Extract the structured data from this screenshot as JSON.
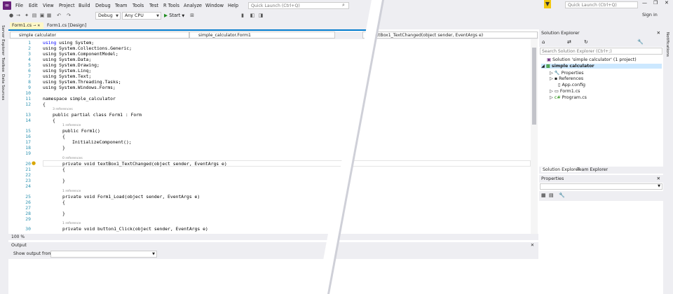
{
  "menu": {
    "file": "File",
    "edit": "Edit",
    "view": "View",
    "project": "Project",
    "build": "Build",
    "debug": "Debug",
    "team": "Team",
    "tools": "Tools",
    "test": "Test",
    "rtools": "R Tools",
    "analyze": "Analyze",
    "window": "Window",
    "help": "Help"
  },
  "toolbar": {
    "config": "Debug",
    "platform": "Any CPU",
    "start": "Start",
    "quick_launch": "Quick Launch (Ctrl+Q)",
    "sign_in": "Sign in"
  },
  "leftdock": {
    "server_explorer": "Server Explorer",
    "toolbox": "Toolbox",
    "data_sources": "Data Sources"
  },
  "rightdock": {
    "notifications": "Notifications"
  },
  "tabs": {
    "form1_cs": "Form1.cs",
    "form1_design": "Form1.cs [Design]"
  },
  "navbar": {
    "project": "simple calculator",
    "class": "simple_calculator.Form1",
    "member": "textBox1_TextChanged(object sender, EventArgs e)"
  },
  "code": {
    "l1": "using System;",
    "l2": "using System.Collections.Generic;",
    "l3": "using System.ComponentModel;",
    "l4": "using System.Data;",
    "l5": "using System.Drawing;",
    "l6": "using System.Linq;",
    "l7": "using System.Text;",
    "l8": "using System.Threading.Tasks;",
    "l9": "using System.Windows.Forms;",
    "l11": "namespace simple_calculator",
    "l12": "{",
    "ref13": "3 references",
    "l13": "public partial class Form1 : Form",
    "l14": "{",
    "ref15": "1 reference",
    "l15": "public Form1()",
    "l16": "{",
    "l17": "InitializeComponent();",
    "l18": "}",
    "ref20": "0 references",
    "l20": "private void textBox1_TextChanged(object sender, EventArgs e)",
    "l21": "{",
    "l23": "}",
    "ref25": "1 reference",
    "l25": "private void Form1_Load(object sender, EventArgs e)",
    "l26": "{",
    "l28": "}",
    "ref30": "1 reference",
    "l30": "private void button1_Click(object sender, EventArgs e)",
    "lines": [
      "1",
      "2",
      "3",
      "4",
      "5",
      "6",
      "7",
      "8",
      "9",
      "10",
      "11",
      "12",
      "13",
      "14",
      "15",
      "16",
      "17",
      "18",
      "19",
      "20",
      "21",
      "22",
      "23",
      "24",
      "25",
      "26",
      "27",
      "28",
      "29",
      "30"
    ]
  },
  "zoom": "100 %",
  "output": {
    "title": "Output",
    "show_from": "Show output from:"
  },
  "solution_explorer": {
    "title": "Solution Explorer",
    "search_placeholder": "Search Solution Explorer (Ctrl+;)",
    "solution": "Solution 'simple calculator' (1 project)",
    "project": "simple calculator",
    "items": [
      "Properties",
      "References",
      "App.config",
      "Form1.cs",
      "Program.cs"
    ],
    "tab_se": "Solution Explorer",
    "tab_te": "Team Explorer"
  },
  "properties": {
    "title": "Properties"
  },
  "colors": {
    "accent": "#007acc",
    "keyword": "#0000ff",
    "type": "#2b91af",
    "vs_purple": "#68217a"
  }
}
